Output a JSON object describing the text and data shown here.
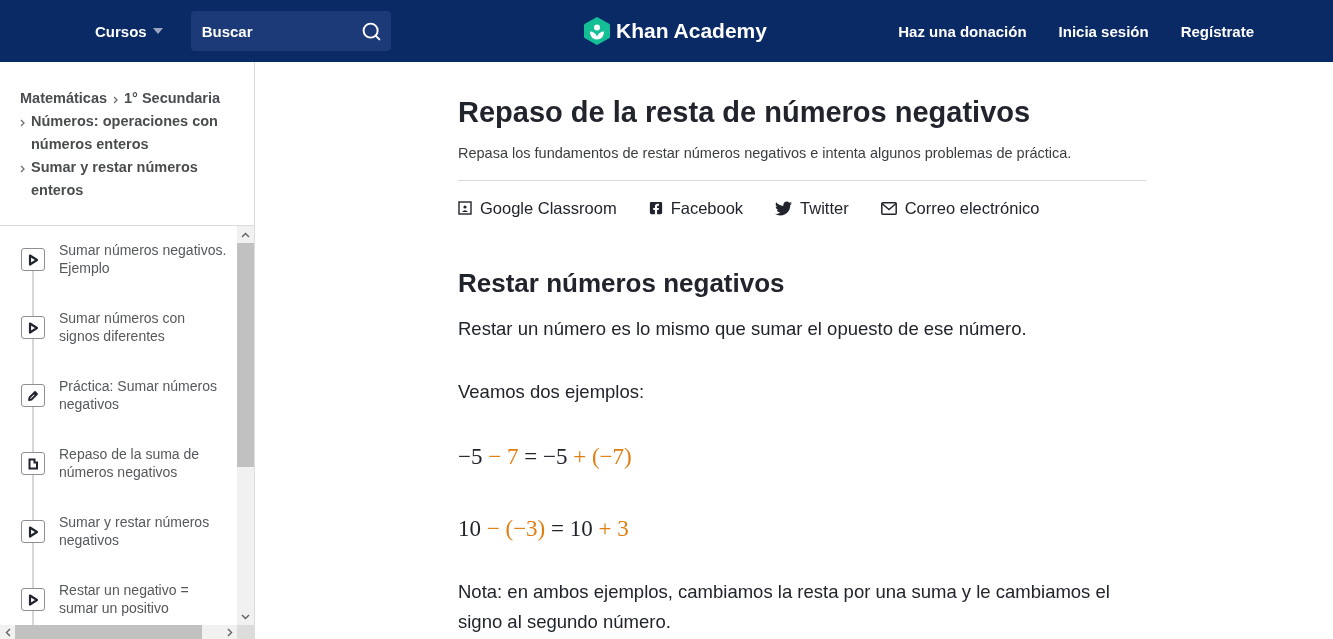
{
  "header": {
    "courses_menu": {
      "label": "Cursos"
    },
    "search": {
      "placeholder": "Buscar"
    },
    "logo": {
      "text": "Khan Academy"
    },
    "links": [
      {
        "label": "Haz una donación"
      },
      {
        "label": "Inicia sesión"
      },
      {
        "label": "Regístrate"
      }
    ]
  },
  "sidebar": {
    "breadcrumb": [
      "Matemáticas",
      "1° Secundaria",
      "Números: operaciones con números enteros",
      "Sumar y restar números enteros"
    ],
    "items": [
      {
        "kind": "video",
        "title": "Sumar números negativos. Ejemplo"
      },
      {
        "kind": "video",
        "title": "Sumar números con signos diferentes"
      },
      {
        "kind": "exercise",
        "title": "Práctica: Sumar números negativos"
      },
      {
        "kind": "article",
        "title": "Repaso de la suma de números negativos"
      },
      {
        "kind": "video",
        "title": "Sumar y restar números negativos"
      },
      {
        "kind": "video",
        "title": "Restar un negativo = sumar un positivo"
      }
    ]
  },
  "article": {
    "title": "Repaso de la resta de números negativos",
    "subtitle": "Repasa los fundamentos de restar números negativos e intenta algunos problemas de práctica.",
    "share": [
      {
        "kind": "classroom",
        "label": "Google Classroom"
      },
      {
        "kind": "facebook",
        "label": "Facebook"
      },
      {
        "kind": "twitter",
        "label": "Twitter"
      },
      {
        "kind": "email",
        "label": "Correo electrónico"
      }
    ],
    "blocks": [
      {
        "kind": "heading",
        "text": "Restar números negativos"
      },
      {
        "kind": "paragraph",
        "text": "Restar un número es lo mismo que sumar el opuesto de ese número."
      },
      {
        "kind": "paragraph",
        "text": "Veamos dos ejemplos:"
      },
      {
        "kind": "equation",
        "terms": [
          {
            "text": "−5",
            "highlight": false
          },
          {
            "text": "−",
            "highlight": true
          },
          {
            "text": "7",
            "highlight": true
          },
          {
            "text": "=",
            "highlight": false
          },
          {
            "text": "−5",
            "highlight": false
          },
          {
            "text": "+",
            "highlight": true
          },
          {
            "text": "(−7)",
            "highlight": true
          }
        ]
      },
      {
        "kind": "equation",
        "terms": [
          {
            "text": "10",
            "highlight": false
          },
          {
            "text": "−",
            "highlight": true
          },
          {
            "text": "(−3)",
            "highlight": true
          },
          {
            "text": "=",
            "highlight": false
          },
          {
            "text": "10",
            "highlight": false
          },
          {
            "text": "+",
            "highlight": true
          },
          {
            "text": "3",
            "highlight": true
          }
        ]
      },
      {
        "kind": "paragraph",
        "text": "Nota: en ambos ejemplos, cambiamos la resta por una suma y le cambiamos el signo al segundo número."
      }
    ]
  }
}
